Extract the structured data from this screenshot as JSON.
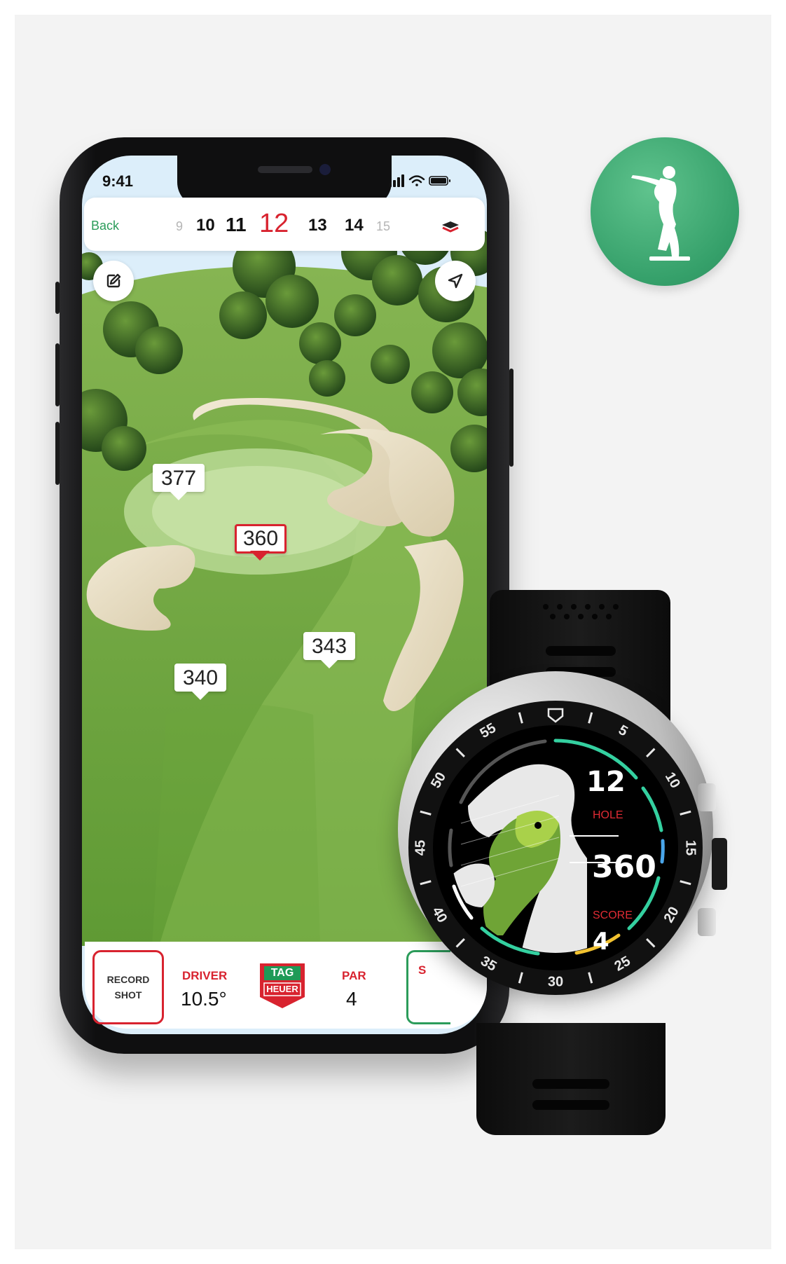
{
  "status_bar": {
    "time": "9:41"
  },
  "header": {
    "back_label": "Back",
    "holes": [
      {
        "num": "9",
        "state": "dim"
      },
      {
        "num": "10",
        "state": "normal"
      },
      {
        "num": "11",
        "state": "normal"
      },
      {
        "num": "12",
        "state": "current"
      },
      {
        "num": "13",
        "state": "normal"
      },
      {
        "num": "14",
        "state": "normal"
      },
      {
        "num": "15",
        "state": "dim"
      }
    ],
    "layers_icon": "layers-icon"
  },
  "map": {
    "edit_icon": "edit-icon",
    "locate_icon": "navigation-arrow-icon",
    "markers": [
      {
        "id": "marker-377",
        "value": "377",
        "kind": "normal"
      },
      {
        "id": "marker-360",
        "value": "360",
        "kind": "flag"
      },
      {
        "id": "marker-343",
        "value": "343",
        "kind": "normal"
      },
      {
        "id": "marker-340",
        "value": "340",
        "kind": "normal"
      }
    ]
  },
  "bottom_bar": {
    "record_line1": "RECORD",
    "record_line2": "SHOT",
    "driver_label": "DRIVER",
    "driver_value": "10.5°",
    "logo_line1": "TAG",
    "logo_line2": "HEUER",
    "par_label": "PAR",
    "par_value": "4",
    "score_partial": "S"
  },
  "watch": {
    "hole_value": "12",
    "hole_label": "HOLE",
    "distance_value": "360",
    "score_label": "SCORE",
    "score_value": "4",
    "bezel_numbers": [
      "5",
      "10",
      "15",
      "20",
      "25",
      "30",
      "35",
      "40",
      "45",
      "50",
      "55"
    ]
  },
  "badge": {
    "icon": "golfer-icon"
  },
  "colors": {
    "accent_red": "#d8232f",
    "accent_green": "#2b9c5a",
    "badge_green": "#3daa70",
    "fairway": "#7fae46"
  }
}
